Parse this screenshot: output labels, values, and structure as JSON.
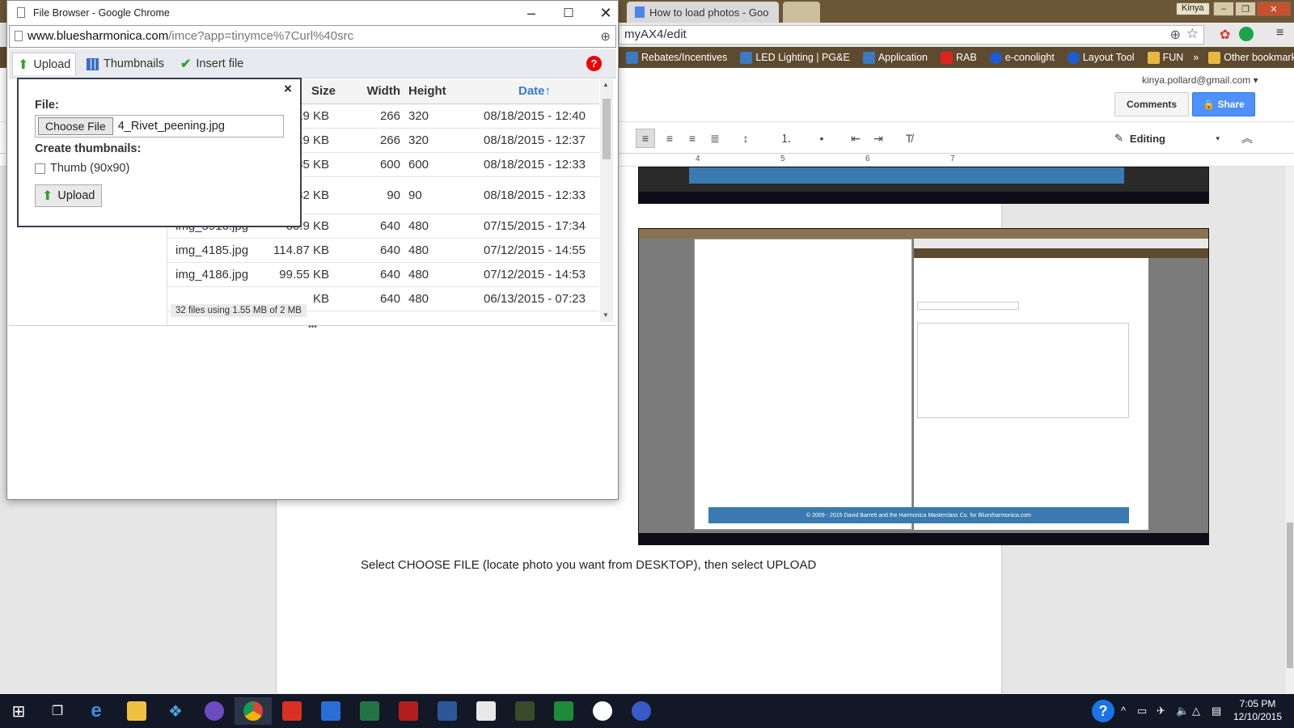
{
  "background": {
    "tab_title": "How to load photos - Goo",
    "user_badge": "Kinya",
    "url_suffix": "myAX4/edit",
    "bookmarks": [
      "Rebates/Incentives",
      "LED Lighting | PG&E",
      "Application",
      "RAB",
      "e-conolight",
      "Layout Tool",
      "FUN",
      "Other bookmarks"
    ],
    "overflow": "»",
    "account_email": "kinya.pollard@gmail.com",
    "comments_label": "Comments",
    "share_label": "Share",
    "editing_label": "Editing",
    "ruler_numbers": [
      "4",
      "5",
      "6",
      "7"
    ],
    "caption": "Select CHOOSE FILE (locate photo you want from DESKTOP), then select UPLOAD",
    "inner_footer_text": "© 2009 - 2015 David Barrett and the Harmonica Masterclass Co. for Bluesharmonica.com",
    "colors": {
      "tabstrip": "#6b5636",
      "bookmarks_bar": "#5e4a2e",
      "share_blue": "#4d90fe",
      "taskbar": "#121826"
    }
  },
  "popup": {
    "window_title": "File Browser - Google Chrome",
    "url_host": "www.bluesharmonica.com",
    "url_path": "/imce?app=tinymce%7Curl%40src",
    "tabs": [
      {
        "label": "Upload",
        "icon": "upload-arrow-icon"
      },
      {
        "label": "Thumbnails",
        "icon": "thumbnails-grid-icon"
      },
      {
        "label": "Insert file",
        "icon": "checkmark-icon"
      }
    ],
    "help_label": "?",
    "columns": {
      "size": "Size",
      "width": "Width",
      "height": "Height",
      "date": "Date↑"
    },
    "files": [
      {
        "name": "",
        "size": "19 KB",
        "width": "266",
        "height": "320",
        "date": "08/18/2015 - 12:40"
      },
      {
        "name": "",
        "size": "19 KB",
        "width": "266",
        "height": "320",
        "date": "08/18/2015 - 12:37"
      },
      {
        "name": "",
        "size": "85 KB",
        "width": "600",
        "height": "600",
        "date": "08/18/2015 - 12:33"
      },
      {
        "name": "",
        "size": "82 KB",
        "width": "90",
        "height": "90",
        "date": "08/18/2015 - 12:33"
      },
      {
        "name": "img_5916.jpg",
        "size": "60.9 KB",
        "width": "640",
        "height": "480",
        "date": "07/15/2015 - 17:34"
      },
      {
        "name": "img_4185.jpg",
        "size": "114.87 KB",
        "width": "640",
        "height": "480",
        "date": "07/12/2015 - 14:55"
      },
      {
        "name": "img_4186.jpg",
        "size": "99.55 KB",
        "width": "640",
        "height": "480",
        "date": "07/12/2015 - 14:53"
      },
      {
        "name": "",
        "size": "KB",
        "width": "640",
        "height": "480",
        "date": "06/13/2015 - 07:23"
      }
    ],
    "status": "32 files using 1.55 MB of 2 MB",
    "upload_form": {
      "close": "×",
      "file_label": "File:",
      "choose_button": "Choose File",
      "selected_file": "4_Rivet_peening.jpg",
      "thumbs_label": "Create thumbnails:",
      "thumb_option": "Thumb (90x90)",
      "thumb_checked": false,
      "upload_button": "Upload"
    }
  },
  "taskbar": {
    "time": "7:05 PM",
    "date": "12/10/2015"
  }
}
